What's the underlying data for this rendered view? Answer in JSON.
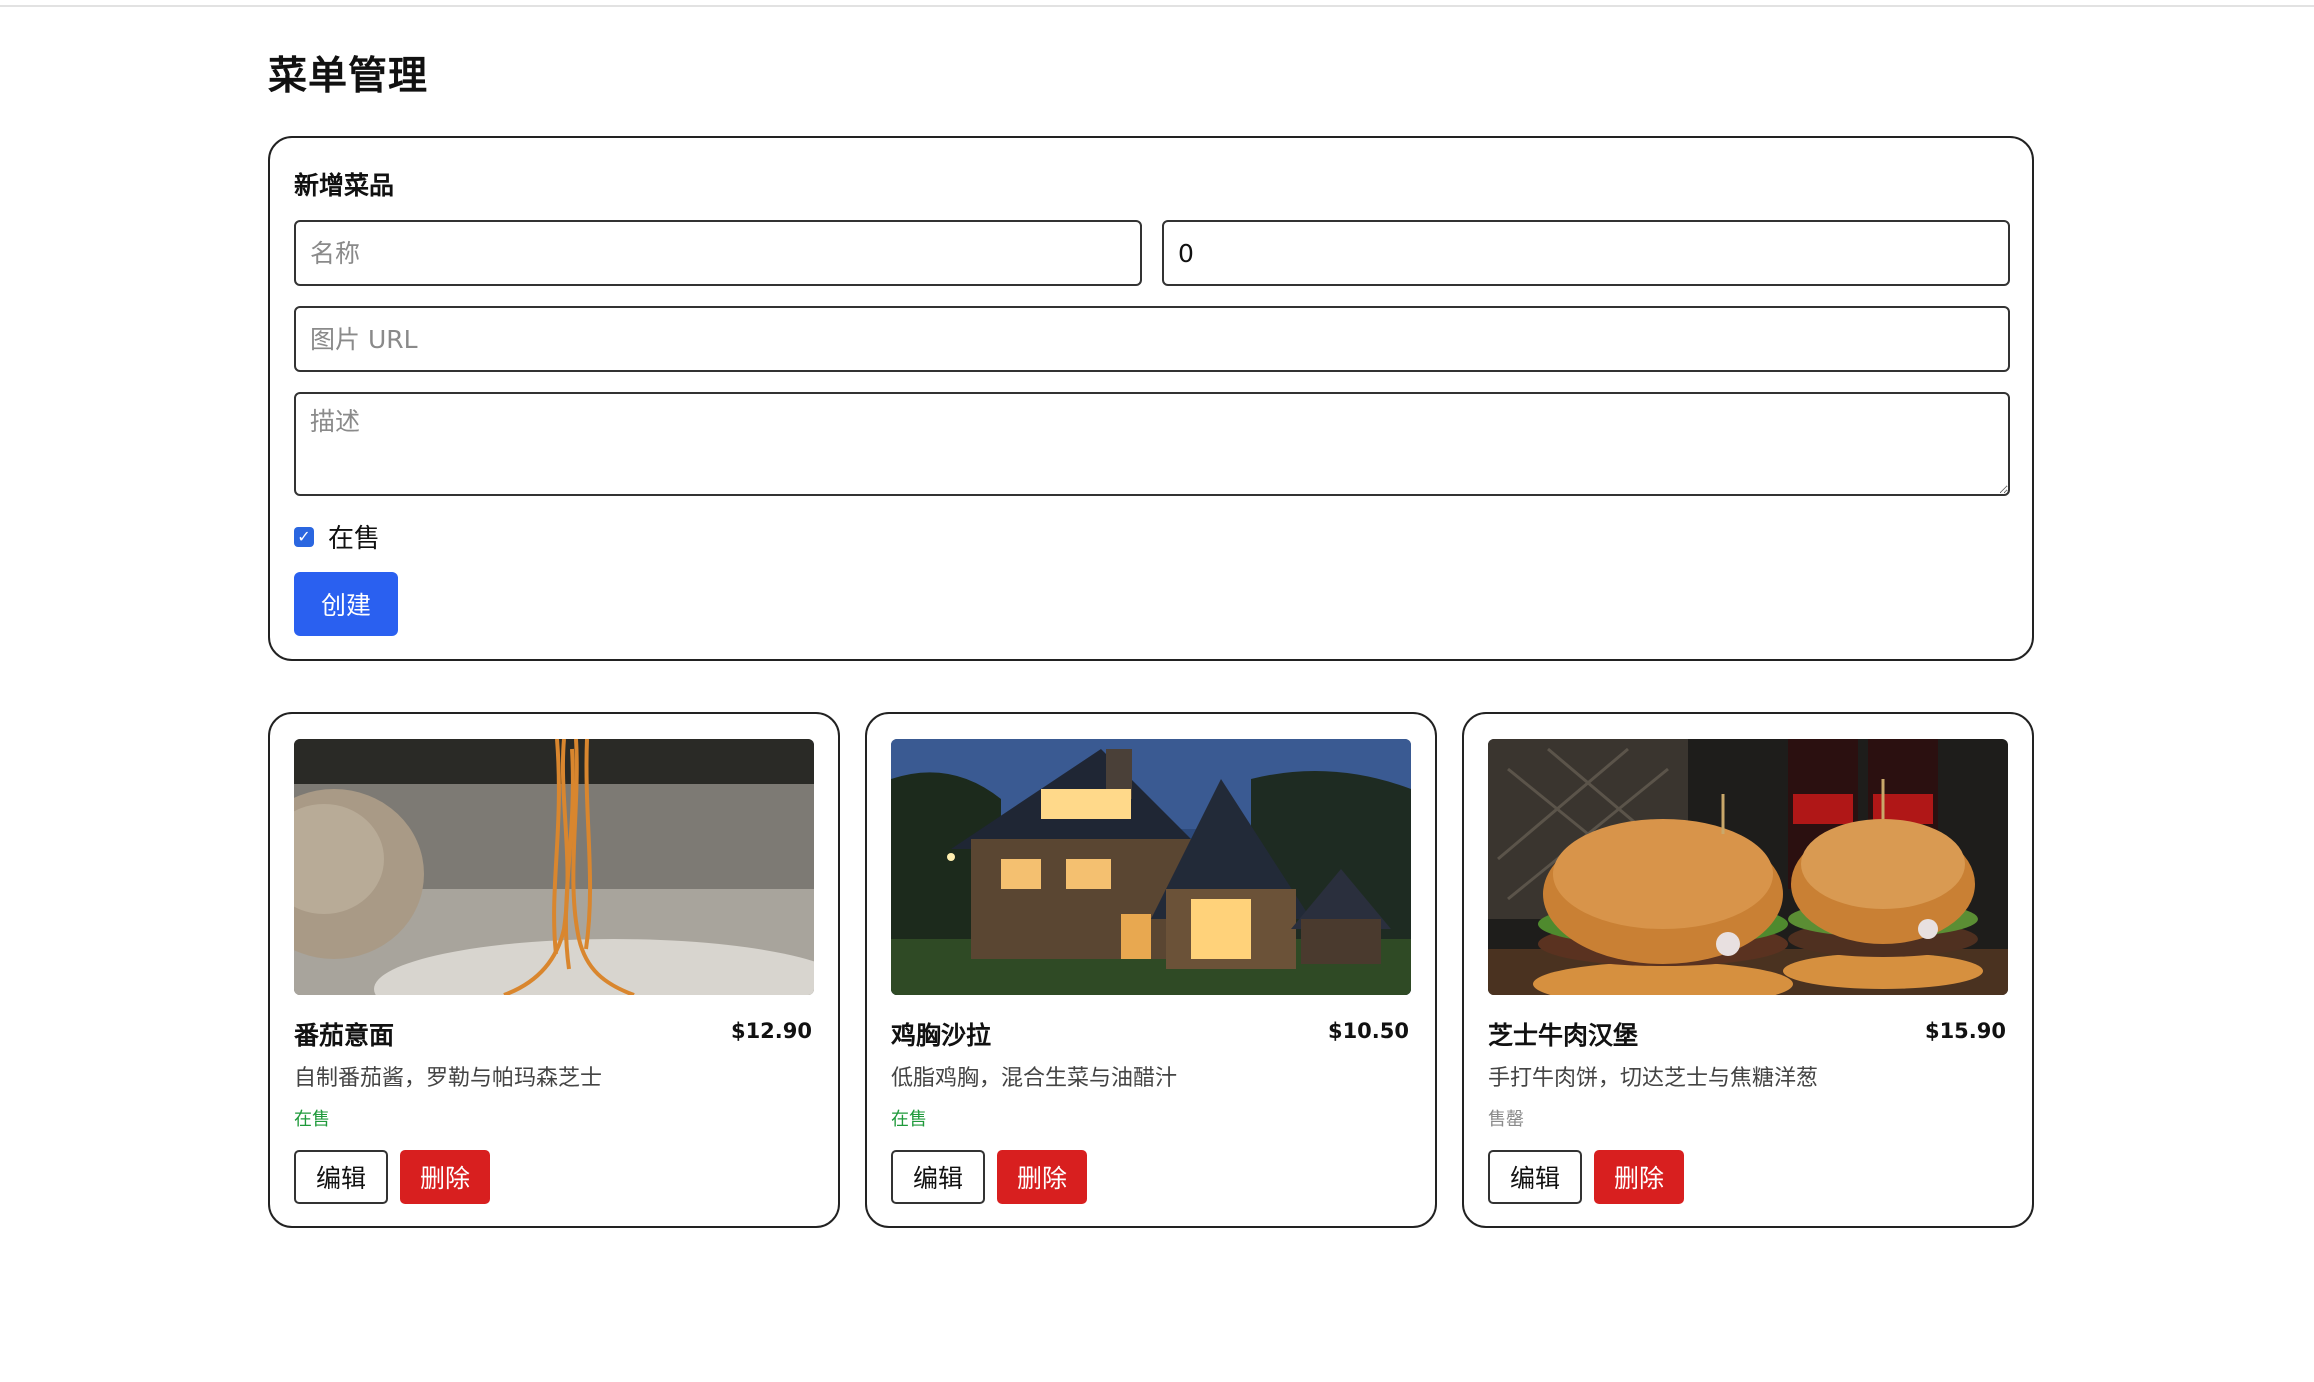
{
  "page": {
    "title": "菜单管理"
  },
  "form": {
    "title": "新增菜品",
    "name_placeholder": "名称",
    "price_value": "0",
    "image_placeholder": "图片 URL",
    "desc_placeholder": "描述",
    "on_sale_label": "在售",
    "on_sale_checked": true,
    "create_label": "创建"
  },
  "colors": {
    "primary": "#2a60f0",
    "danger": "#d81f1f",
    "success": "#1f9a3b",
    "muted": "#8a8a8a"
  },
  "dishes": [
    {
      "name": "番茄意面",
      "price": "$12.90",
      "description": "自制番茄酱，罗勒与帕玛森芝士",
      "status": "在售",
      "image": "spaghetti-photo",
      "edit_label": "编辑",
      "delete_label": "删除"
    },
    {
      "name": "鸡胸沙拉",
      "price": "$10.50",
      "description": "低脂鸡胸，混合生菜与油醋汁",
      "status": "在售",
      "image": "house-photo",
      "edit_label": "编辑",
      "delete_label": "删除"
    },
    {
      "name": "芝士牛肉汉堡",
      "price": "$15.90",
      "description": "手打牛肉饼，切达芝士与焦糖洋葱",
      "status": "售罄",
      "image": "burger-photo",
      "edit_label": "编辑",
      "delete_label": "删除"
    }
  ]
}
